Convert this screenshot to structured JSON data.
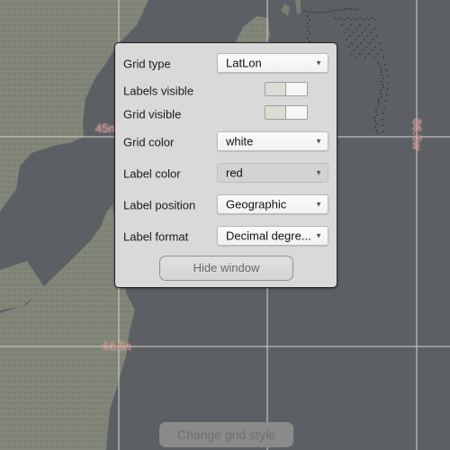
{
  "map": {
    "colors": {
      "water": "#5c6064",
      "land": "#7f8476",
      "grid_line": "#c9c6bc",
      "grid_label": "#c8706a"
    },
    "grid_labels": {
      "lat_top": "45n",
      "lat_bottom": "44.5n",
      "lon_right": "86.5w"
    }
  },
  "panel": {
    "rows": [
      {
        "label": "Grid type",
        "control": "select",
        "value": "LatLon"
      },
      {
        "label": "Labels visible",
        "control": "toggle",
        "value": true
      },
      {
        "label": "Grid visible",
        "control": "toggle",
        "value": true
      },
      {
        "label": "Grid color",
        "control": "select",
        "value": "white"
      },
      {
        "label": "Label color",
        "control": "select",
        "value": "red",
        "disabled": true
      },
      {
        "label": "Label position",
        "control": "select",
        "value": "Geographic"
      },
      {
        "label": "Label format",
        "control": "select",
        "value": "Decimal degre..."
      }
    ],
    "hide_button": "Hide window"
  },
  "change_grid_button": "Change grid style",
  "icons": {
    "dropdown_arrow": "▼"
  }
}
